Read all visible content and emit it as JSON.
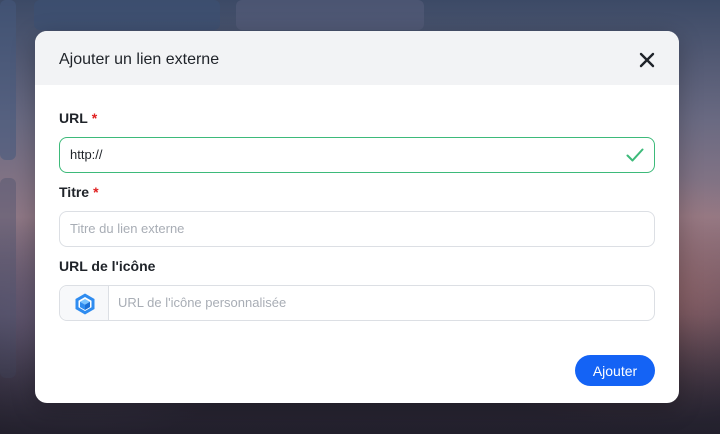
{
  "dialog": {
    "title": "Ajouter un lien externe",
    "close_icon": "close-icon"
  },
  "form": {
    "url": {
      "label": "URL",
      "required_marker": "*",
      "value": "http://",
      "status_icon": "check-icon",
      "status_color": "#3dba7a"
    },
    "title": {
      "label": "Titre",
      "required_marker": "*",
      "value": "",
      "placeholder": "Titre du lien externe"
    },
    "icon_url": {
      "label": "URL de l'icône",
      "value": "",
      "placeholder": "URL de l'icône personnalisée",
      "preview_icon": "cube-icon"
    }
  },
  "actions": {
    "submit_label": "Ajouter",
    "submit_color": "#1463f5"
  }
}
